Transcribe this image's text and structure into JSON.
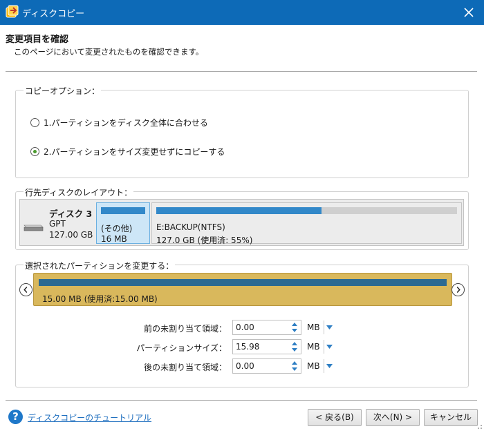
{
  "window": {
    "title": "ディスクコピー",
    "close_icon": "close-icon",
    "accent_color": "#0d6ab7"
  },
  "header": {
    "title": "変更項目を確認",
    "subtitle": "このページにおいて変更されたものを確認できます。"
  },
  "copy_options": {
    "label": "コピーオプション：",
    "options": [
      {
        "label": "1.パーティションをディスク全体に合わせる",
        "selected": false
      },
      {
        "label": "2.パーティションをサイズ変更せずにコピーする",
        "selected": true
      }
    ]
  },
  "layout": {
    "label": "行先ディスクのレイアウト：",
    "disk": {
      "name": "ディスク 3",
      "type": "GPT",
      "size": "127.00 GB",
      "icon": "hard-drive-icon"
    },
    "partitions": [
      {
        "label": "(その他)",
        "size": "16 MB",
        "used_fraction": 1.0,
        "selected": true
      },
      {
        "label": "E:BACKUP(NTFS)",
        "size": "127.0 GB (使用済: 55%)",
        "used_fraction": 0.55,
        "selected": false
      }
    ]
  },
  "change_partition": {
    "label": "選択されたパーティションを変更する：",
    "summary": "15.00 MB (使用済:15.00 MB)",
    "panel_color": "#d9b85c",
    "bar_color": "#2c6a92",
    "fields": [
      {
        "label": "前の未割り当て領域：",
        "value": "0.00",
        "unit": "MB"
      },
      {
        "label": "パーティションサイズ：",
        "value": "15.98",
        "unit": "MB"
      },
      {
        "label": "後の未割り当て領域：",
        "value": "0.00",
        "unit": "MB"
      }
    ]
  },
  "footer": {
    "tutorial_link": "ディスクコピーのチュートリアル",
    "back_button": "< 戻る(B)",
    "next_button": "次へ(N) >",
    "cancel_button": "キャンセル"
  }
}
